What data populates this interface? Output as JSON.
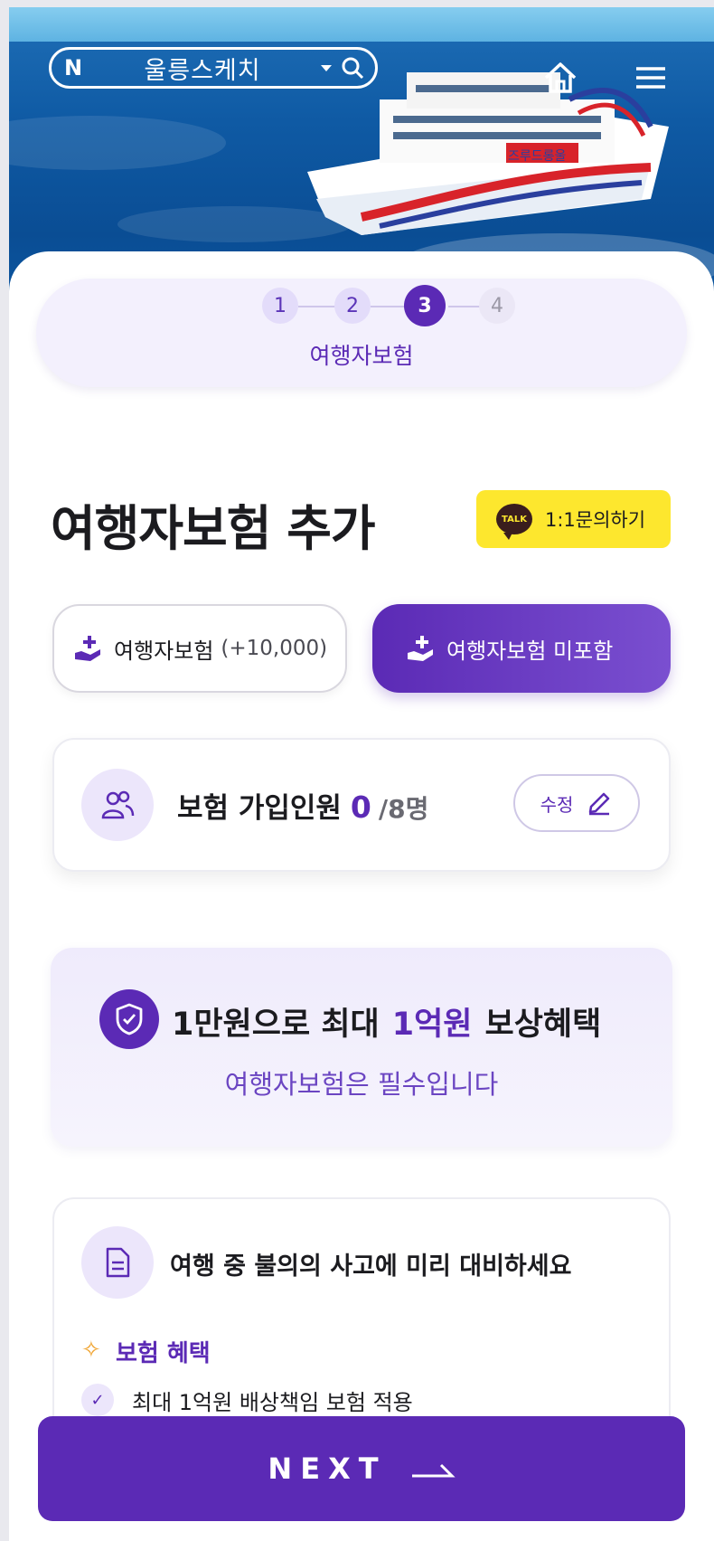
{
  "header": {
    "search_logo": "N",
    "search_text": "울릉스케치",
    "ship_brand": "즈루드롱울",
    "icons": [
      "home-icon",
      "menu-icon",
      "search-icon",
      "dropdown-caret-icon"
    ]
  },
  "stepper": {
    "steps": [
      "1",
      "2",
      "3",
      "4"
    ],
    "active_step": 3,
    "current_title": "여행자보험"
  },
  "main": {
    "title": "여행자보험 추가",
    "talk_button": {
      "badge": "TALK",
      "label": "1:1문의하기"
    },
    "option_include": {
      "label": "여행자보험",
      "price": "(+10,000)"
    },
    "option_exclude": {
      "label": "여행자보험 미포함"
    },
    "people": {
      "label": "보험 가입인원",
      "count": "0",
      "max": "/8명",
      "edit_label": "수정"
    },
    "benefit": {
      "prefix": "1만원으로 최대",
      "highlight": "1억원",
      "suffix": "보상혜택",
      "sub": "여행자보험은 필수입니다"
    },
    "info": {
      "title": "여행 중 불의의 사고에 미리 대비하세요",
      "section": "보험 혜택",
      "items": [
        "최대 1억원 배상책임 보험 적용"
      ]
    }
  },
  "footer": {
    "next_label": "NEXT"
  },
  "colors": {
    "primary": "#5b2ab5",
    "kakao_yellow": "#fde72e",
    "soft_purple": "#ece6fb"
  }
}
